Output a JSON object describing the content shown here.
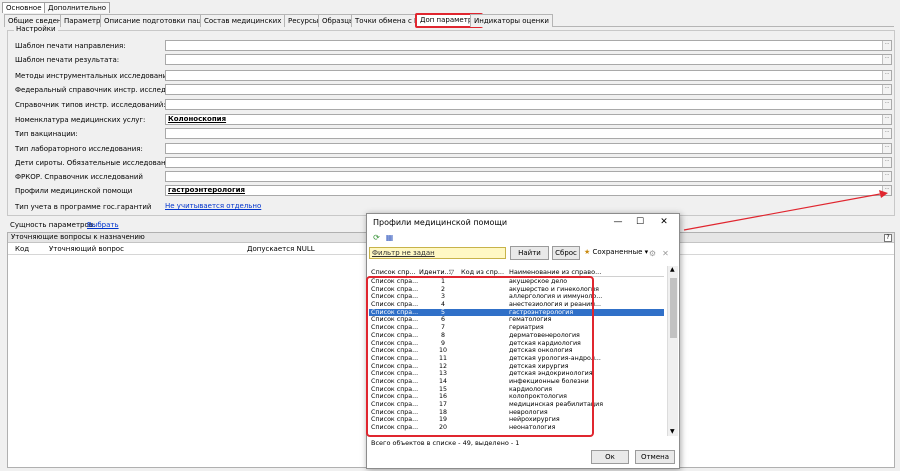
{
  "top_tabs": [
    "Основное",
    "Дополнительно"
  ],
  "tabs": [
    "Общие сведения",
    "Параметры",
    "Описание подготовки пациента",
    "Состав медицинских услуг",
    "Ресурсы",
    "Образцы",
    "Точки обмена с ПИС",
    "Доп параметры",
    "Индикаторы оценки"
  ],
  "settings": {
    "title": "Настройки",
    "fields": [
      {
        "label": "Шаблон печати направления:",
        "value": ""
      },
      {
        "label": "Шаблон печати результата:",
        "value": ""
      },
      {
        "label": "Методы инструментальных исследований:",
        "value": ""
      },
      {
        "label": "Федеральный справочник инстр. исследований:",
        "value": ""
      },
      {
        "label": "Справочник типов инстр. исследований:",
        "value": ""
      },
      {
        "label": "Номенклатура медицинских услуг:",
        "value": "Колоноскопия"
      },
      {
        "label": "Тип вакцинации:",
        "value": ""
      },
      {
        "label": "Тип лабораторного исследования:",
        "value": ""
      },
      {
        "label": "Дети сироты. Обязательные исследования:",
        "value": ""
      },
      {
        "label": "ФРКОР. Справочник исследований",
        "value": ""
      },
      {
        "label": "Профили медицинской помощи",
        "value": "гастроэнтерология"
      }
    ],
    "gos_label": "Тип учета в программе гос.гарантий",
    "gos_value": "Не учитывается отдельно"
  },
  "essence": {
    "label": "Сущность параметров:",
    "link": "Выбрать"
  },
  "panel": {
    "title": "Уточняющие вопросы к назначению",
    "help": "?",
    "columns": [
      "Код",
      "Уточняющий вопрос",
      "Допускается NULL"
    ]
  },
  "dialog": {
    "title": "Профили медицинской помощи",
    "filter": "Фильтр не задан",
    "find": "Найти",
    "reset": "Сброс",
    "saved": "Сохраненные",
    "columns": [
      "Список спр...",
      "Иденти...",
      "Код из спр...",
      "Наименование из справо..."
    ],
    "rows": [
      {
        "list": "Список спра...",
        "id": "1",
        "name": "акушерское дело"
      },
      {
        "list": "Список спра...",
        "id": "2",
        "name": "акушерство и гинекология"
      },
      {
        "list": "Список спра...",
        "id": "3",
        "name": "аллергология и иммуноло..."
      },
      {
        "list": "Список спра...",
        "id": "4",
        "name": "анестезиология и реаним..."
      },
      {
        "list": "Список спра...",
        "id": "5",
        "name": "гастроэнтерология"
      },
      {
        "list": "Список спра...",
        "id": "6",
        "name": "гематология"
      },
      {
        "list": "Список спра...",
        "id": "7",
        "name": "гериатрия"
      },
      {
        "list": "Список спра...",
        "id": "8",
        "name": "дерматовенерология"
      },
      {
        "list": "Список спра...",
        "id": "9",
        "name": "детская кардиология"
      },
      {
        "list": "Список спра...",
        "id": "10",
        "name": "детская онкология"
      },
      {
        "list": "Список спра...",
        "id": "11",
        "name": "детская урология-андрол..."
      },
      {
        "list": "Список спра...",
        "id": "12",
        "name": "детская хирургия"
      },
      {
        "list": "Список спра...",
        "id": "13",
        "name": "детская эндокринология"
      },
      {
        "list": "Список спра...",
        "id": "14",
        "name": "инфекционные болезни"
      },
      {
        "list": "Список спра...",
        "id": "15",
        "name": "кардиология"
      },
      {
        "list": "Список спра...",
        "id": "16",
        "name": "колопроктология"
      },
      {
        "list": "Список спра...",
        "id": "17",
        "name": "медицинская реабилитация"
      },
      {
        "list": "Список спра...",
        "id": "18",
        "name": "неврология"
      },
      {
        "list": "Список спра...",
        "id": "19",
        "name": "нейрохирургия"
      },
      {
        "list": "Список спра...",
        "id": "20",
        "name": "неонатология"
      }
    ],
    "selected_index": 4,
    "status": "Всего объектов в списке - 49, выделено - 1",
    "ok": "Ок",
    "cancel": "Отмена"
  },
  "colors": {
    "accent_red": "#e0262f",
    "selection_blue": "#3070c8",
    "filter_yellow": "#fff8c4"
  }
}
